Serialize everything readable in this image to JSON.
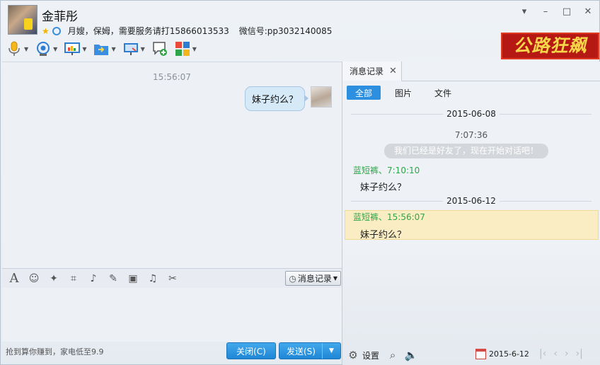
{
  "contact": {
    "name": "金菲彤",
    "signature": "月嫂，保姆，需要服务请打15866013533",
    "wechat": "微信号:pp3032140085"
  },
  "window_controls": {
    "menu": "▾",
    "minimize": "–",
    "maximize": "□",
    "close": "✕"
  },
  "brand_logo": {
    "text": "公路狂飙",
    "bg_color": "#b61813",
    "text_color": "#f7d74a"
  },
  "toolbar": {
    "items": [
      "voice-call",
      "video-call",
      "remote-desktop",
      "send-file",
      "screen-share",
      "text-message",
      "apps"
    ]
  },
  "chat": {
    "timestamp": "15:56:07",
    "messages": [
      {
        "text": "妹子约么？",
        "direction": "outgoing"
      }
    ]
  },
  "editor_toolbar": {
    "history_label": "消息记录"
  },
  "footer": {
    "ad_text": "抢到算你赚到，家电低至9.9",
    "close_label": "关闭(C)",
    "send_label": "发送(S)",
    "accent_color": "#2d8fe0"
  },
  "history_panel": {
    "tab_label": "消息记录",
    "filters": [
      "全部",
      "图片",
      "文件"
    ],
    "records": {
      "date1": "2015-06-08",
      "time1": "7:07:36",
      "system_msg": "我们已经是好友了，现在开始对话吧！",
      "sender1": "蓝短裤、7:10:10",
      "msg1": "妹子约么？",
      "date2": "2015-06-12",
      "sender2": "蓝短裤、15:56:07",
      "msg2": "妹子约么？"
    },
    "settings_label": "设置",
    "current_date": "2015-6-12",
    "sender_color": "#2ea54a",
    "highlight_color": "#fbedc3"
  }
}
